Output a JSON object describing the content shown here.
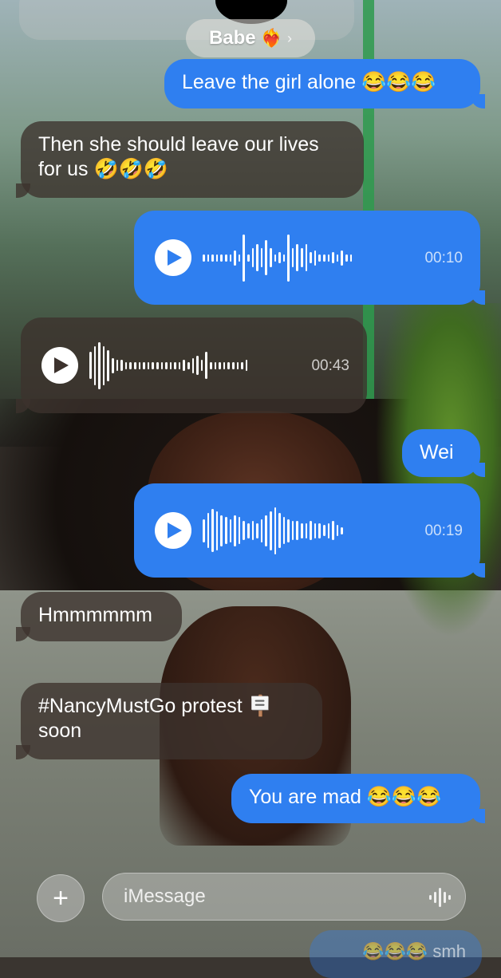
{
  "header": {
    "contact_name": "Babe",
    "heart_emoji": "❤️‍🔥",
    "chevron": "›"
  },
  "messages": [
    {
      "kind": "sent-text",
      "text": "Leave the girl alone 😂😂😂"
    },
    {
      "kind": "recv-text",
      "text": "Then she should leave our lives for us 🤣🤣🤣"
    },
    {
      "kind": "sent-audio",
      "duration": "00:10"
    },
    {
      "kind": "recv-audio",
      "duration": "00:43"
    },
    {
      "kind": "sent-text",
      "text": "Wei"
    },
    {
      "kind": "sent-audio",
      "duration": "00:19"
    },
    {
      "kind": "recv-text",
      "text": "Hmmmmmm"
    },
    {
      "kind": "recv-text",
      "text": "#NancyMustGo protest 🪧 soon"
    },
    {
      "kind": "sent-text",
      "text": "You are mad 😂😂😂"
    }
  ],
  "composer": {
    "placeholder": "iMessage",
    "plus": "+"
  },
  "bottom_ghost": {
    "text": "😂😂😂 smh"
  },
  "colors": {
    "sent": "#2f7ff0",
    "received": "rgba(60,50,45,.78)"
  }
}
